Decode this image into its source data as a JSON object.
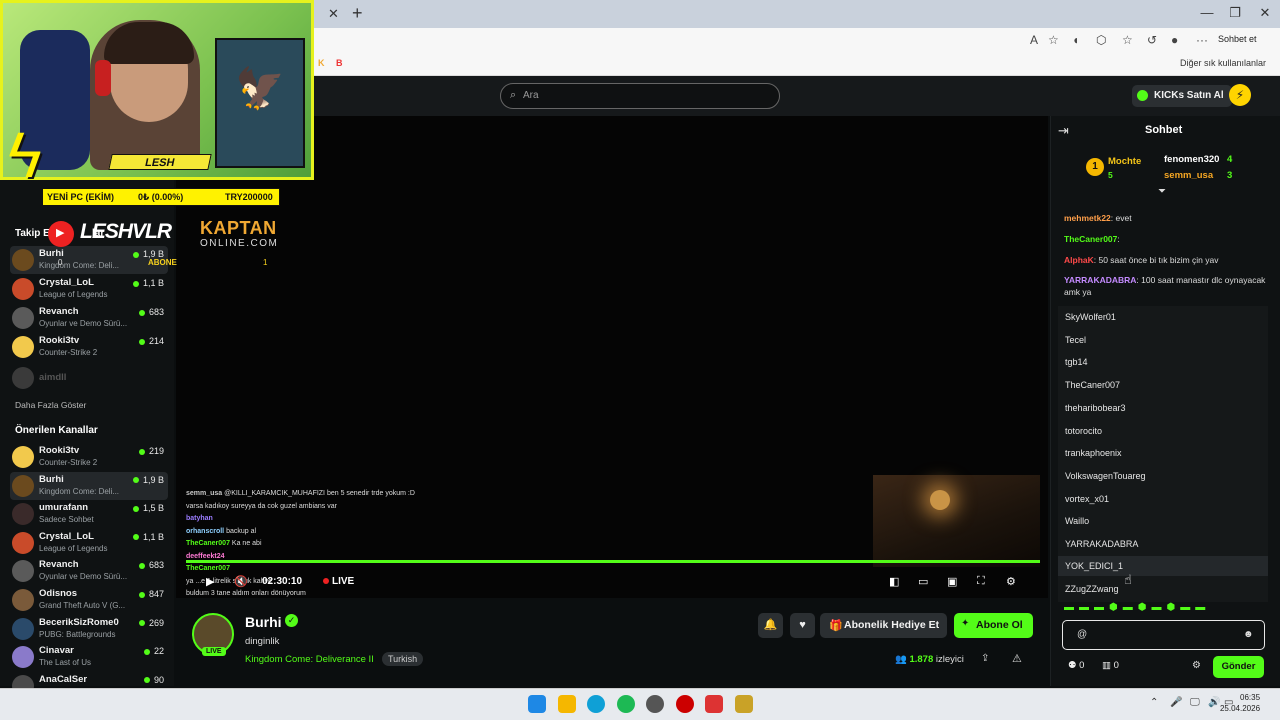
{
  "browser": {
    "tab_close": "✕",
    "new_tab": "+",
    "chat_button": "Sohbet et",
    "bookmarks_other": "Diğer sık kullanılanlar",
    "bm_k": "K",
    "bm_b": "B"
  },
  "header": {
    "search_placeholder": "Ara",
    "kicks_button": "KICKs Satın Al"
  },
  "overlay": {
    "lesh_tag": "LESH",
    "goal_label": "YENİ PC (EKİM)",
    "goal_progress": "0₺ (0.00%)",
    "goal_target": "TRY200000",
    "logo": "LESHVLR",
    "abone": "ABONE",
    "zero": "0",
    "kaptan": "KAPTAN",
    "kaptan_sub": "ONLINE.COM",
    "kaptan_count": "1"
  },
  "sidebar": {
    "following_title": "Takip E",
    "following_suffix": "lar",
    "following": [
      {
        "name": "Burhi",
        "game": "Kingdom Come: Deli...",
        "count": "1,9 B",
        "color": "#6b4a1e"
      },
      {
        "name": "Crystal_LoL",
        "game": "League of Legends",
        "count": "1,1 B",
        "color": "#c94b2a"
      },
      {
        "name": "Revanch",
        "game": "Oyunlar ve Demo Sürü...",
        "count": "683",
        "color": "#5a5a5a"
      },
      {
        "name": "Rooki3tv",
        "game": "Counter-Strike 2",
        "count": "214",
        "color": "#f2c94c"
      }
    ],
    "offline": {
      "name": "aimdll"
    },
    "show_more": "Daha Fazla Göster",
    "recommended_title": "Önerilen Kanallar",
    "recommended": [
      {
        "name": "Rooki3tv",
        "game": "Counter-Strike 2",
        "count": "219",
        "color": "#f2c94c"
      },
      {
        "name": "Burhi",
        "game": "Kingdom Come: Deli...",
        "count": "1,9 B",
        "color": "#6b4a1e"
      },
      {
        "name": "umurafann",
        "game": "Sadece Sohbet",
        "count": "1,5 B",
        "color": "#3a2a2a"
      },
      {
        "name": "Crystal_LoL",
        "game": "League of Legends",
        "count": "1,1 B",
        "color": "#c94b2a"
      },
      {
        "name": "Revanch",
        "game": "Oyunlar ve Demo Sürü...",
        "count": "683",
        "color": "#5a5a5a"
      },
      {
        "name": "Odisnos",
        "game": "Grand Theft Auto V (G...",
        "count": "847",
        "color": "#7a5a3a"
      },
      {
        "name": "BecerikSizRome0",
        "game": "PUBG: Battlegrounds",
        "count": "269",
        "color": "#2a4a6a"
      },
      {
        "name": "Cinavar",
        "game": "The Last of Us",
        "count": "22",
        "color": "#8a7aca"
      },
      {
        "name": "AnaCalSer",
        "game": "",
        "count": "90",
        "color": "#4a4a4a"
      }
    ]
  },
  "video": {
    "overlay_chat": [
      {
        "user": "semm_usa",
        "color": "#c9c9c9",
        "text": "@KILLI_KARAMCIK_MUHAFIZI ben 5 senedir trde yokum :D"
      },
      {
        "user": "",
        "color": "#c9c9c9",
        "text": "varsa kadıkoy sureyya da cok guzel ambians var"
      },
      {
        "user": "batyhan",
        "color": "#9b7cff",
        "text": ""
      },
      {
        "user": "orhanscroll",
        "color": "#8fd0ff",
        "text": "backup al"
      },
      {
        "user": "TheCaner007",
        "color": "#53fc18",
        "text": "Ka ne abi"
      },
      {
        "user": "deeffeekt24",
        "color": "#ff7bd5",
        "text": ""
      },
      {
        "user": "TheCaner007",
        "color": "#53fc18",
        "text": ""
      },
      {
        "user": "",
        "color": "#c9c9c9",
        "text": "ya ...e 1 litrelik soğuk kahve"
      },
      {
        "user": "",
        "color": "#c9c9c9",
        "text": "buldum 3 tane aldım onları dönüyorum"
      }
    ],
    "time": "02:30:10",
    "live": "LIVE"
  },
  "info": {
    "live_badge": "LIVE",
    "streamer": "Burhi",
    "title": "dinginlik",
    "game": "Kingdom Come: Deliverance II",
    "language": "Turkish",
    "gift_button": "Abonelik Hediye Et",
    "subscribe_button": "Abone Ol",
    "viewer_count": "1.878",
    "viewer_label": "izleyici"
  },
  "chat": {
    "title": "Sohbet",
    "leaders": [
      {
        "name": "Mochte",
        "count": "5"
      },
      {
        "name": "fenomen320",
        "count": "4"
      },
      {
        "name": "semm_usa",
        "count": "3"
      }
    ],
    "messages": [
      {
        "user": "mehmetk22",
        "color": "#ff9f4a",
        "text": "evet"
      },
      {
        "user": "TheCaner007",
        "color": "#53fc18",
        "text": ""
      },
      {
        "user": "AlphaK",
        "color": "#ff4a4a",
        "text": "50 saat önce bi tık bizim çin yav"
      },
      {
        "user": "YARRAKADABRA",
        "color": "#c48bff",
        "text": "100 saat manastır dlc oynayacak amk ya"
      }
    ],
    "user_list": [
      "SkyWolfer01",
      "Tecel",
      "tgb14",
      "TheCaner007",
      "theharibobear3",
      "totorocito",
      "trankaphoenix",
      "VolkswagenTouareg",
      "vortex_x01",
      "Waillo",
      "YARRAKADABRA",
      "YOK_EDICI_1",
      "ZZugZZwang"
    ],
    "input_value": "@",
    "stat_points": "0",
    "stat_store": "0",
    "send_button": "Gönder"
  },
  "taskbar": {
    "time": "06:35",
    "date": "25.04.2026"
  }
}
